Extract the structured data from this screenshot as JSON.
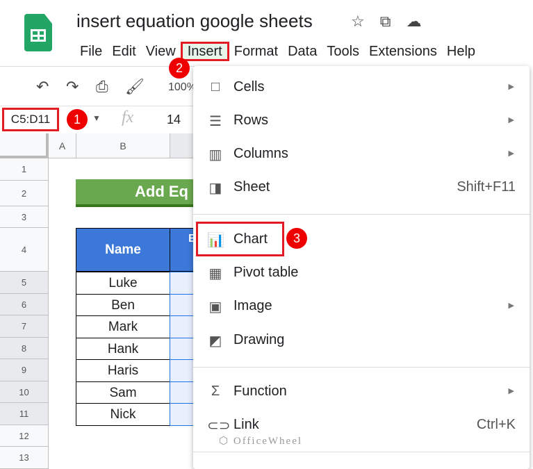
{
  "doc": {
    "title": "insert equation google sheets",
    "icons": [
      "star-icon",
      "move-to-folder-icon",
      "cloud-saved-icon"
    ]
  },
  "menubar": [
    "File",
    "Edit",
    "View",
    "Insert",
    "Format",
    "Data",
    "Tools",
    "Extensions",
    "Help"
  ],
  "toolbar": {
    "zoom": "100%"
  },
  "formula_bar": {
    "name_box": "C5:D11",
    "fx": "fx",
    "value": "14"
  },
  "grid": {
    "columns": [
      "A",
      "B"
    ],
    "rows": [
      "1",
      "2",
      "3",
      "4",
      "5",
      "6",
      "7",
      "8",
      "9",
      "10",
      "11",
      "12",
      "13"
    ],
    "heading": "Add Eq",
    "table_header": "Name",
    "table_header_c": "E",
    "names": [
      "Luke",
      "Ben",
      "Mark",
      "Hank",
      "Haris",
      "Sam",
      "Nick"
    ]
  },
  "steps": [
    "1",
    "2",
    "3"
  ],
  "insert_menu": {
    "items": [
      {
        "label": "Cells",
        "icon": "cells-icon",
        "submenu": true
      },
      {
        "label": "Rows",
        "icon": "rows-icon",
        "submenu": true
      },
      {
        "label": "Columns",
        "icon": "columns-icon",
        "submenu": true
      },
      {
        "label": "Sheet",
        "icon": "sheet-icon",
        "shortcut": "Shift+F11"
      },
      {
        "label": "Chart",
        "icon": "chart-icon"
      },
      {
        "label": "Pivot table",
        "icon": "pivot-table-icon"
      },
      {
        "label": "Image",
        "icon": "image-icon",
        "submenu": true
      },
      {
        "label": "Drawing",
        "icon": "drawing-icon"
      },
      {
        "label": "Function",
        "icon": "sigma-icon",
        "submenu": true
      },
      {
        "label": "Link",
        "icon": "link-icon",
        "shortcut": "Ctrl+K"
      }
    ]
  },
  "watermark": "OfficeWheel",
  "colors": {
    "highlight": "#e31b23",
    "header_blue": "#3c78d8",
    "heading_green": "#6aa84f"
  }
}
